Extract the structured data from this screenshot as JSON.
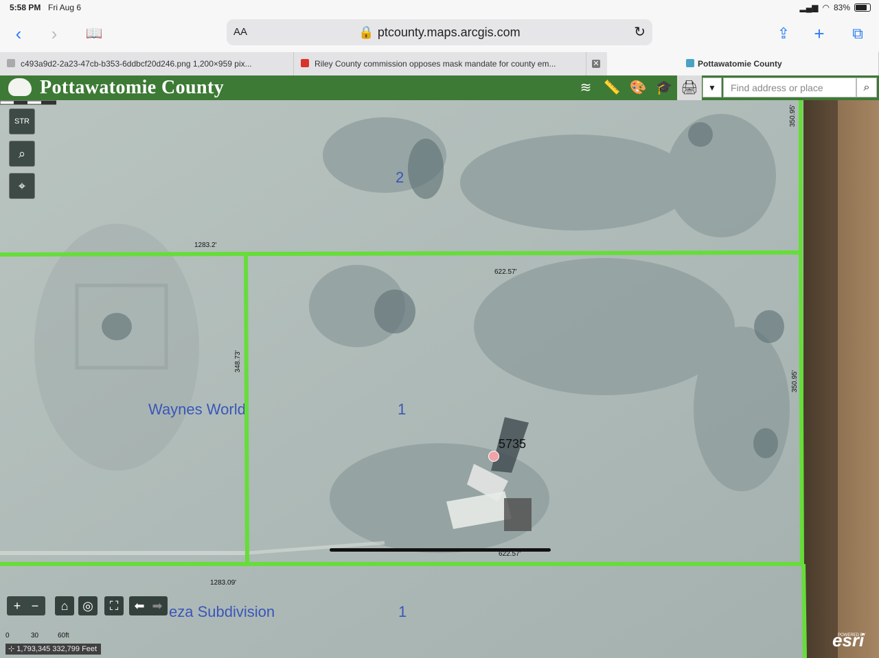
{
  "status": {
    "time": "5:58 PM",
    "date": "Fri Aug 6",
    "battery": "83%"
  },
  "browser": {
    "reader_label": "AA",
    "url": "ptcounty.maps.arcgis.com",
    "tabs": [
      {
        "label": "c493a9d2-2a23-47cb-b353-6ddbcf20d246.png 1,200×959 pix..."
      },
      {
        "label": "Riley County commission opposes mask mandate for county em..."
      },
      {
        "label": "Pottawatomie County"
      }
    ]
  },
  "app": {
    "title": "Pottawatomie County",
    "search": {
      "placeholder": "Find address or place"
    },
    "side_tools": [
      "STR"
    ]
  },
  "map": {
    "dimensions": [
      "1283.2'",
      "622.57'",
      "348.73'",
      "350.95'",
      "350.95'",
      "622.57'",
      "1283.09'"
    ],
    "parcels": [
      "2",
      "1",
      "1"
    ],
    "subdivisions": [
      "Waynes World",
      "eza Subdivision"
    ],
    "address": "5735",
    "scale_labels": [
      "0",
      "30",
      "60ft"
    ],
    "coordinates": "1,793,345 332,799 Feet",
    "attribution": "esri",
    "attribution_small": "POWERED BY"
  },
  "colors": {
    "header": "#3d7a35",
    "parcel_line": "#66dd3a",
    "label": "#3a56b8",
    "accent": "#2a7cf6"
  }
}
